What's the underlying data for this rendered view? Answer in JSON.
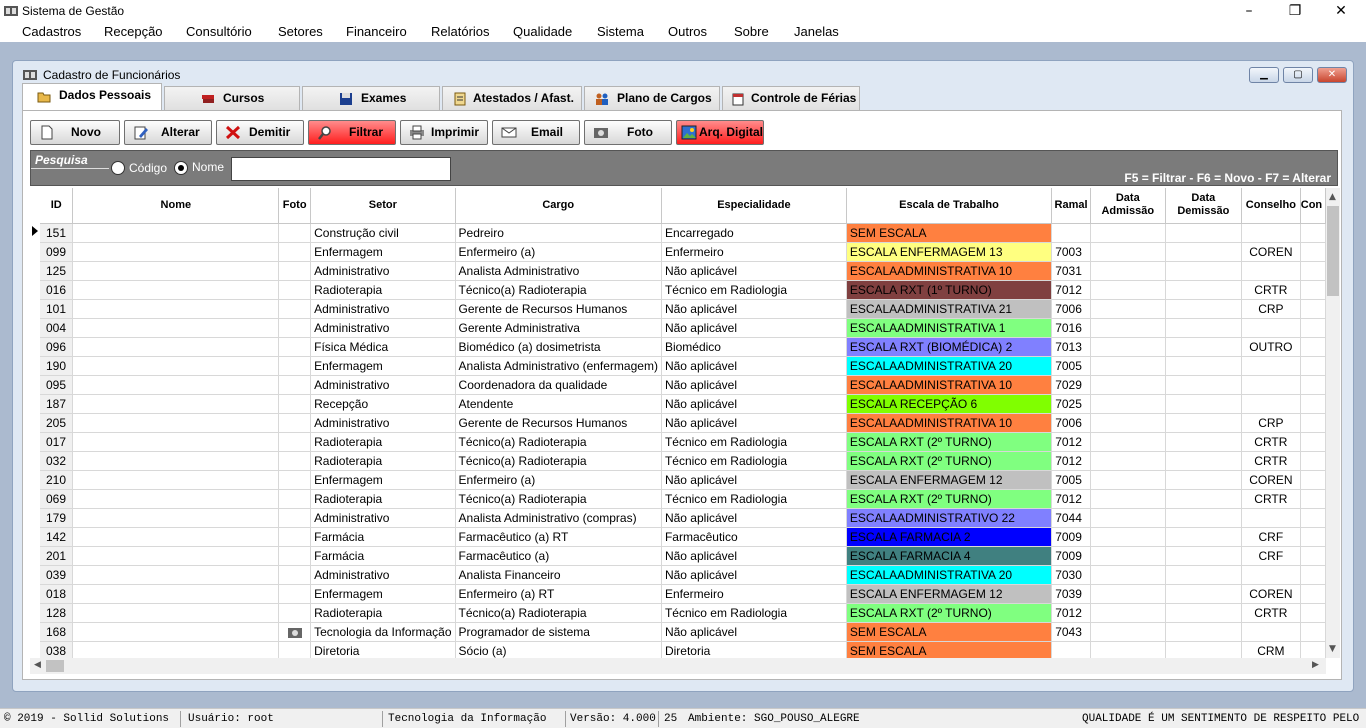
{
  "app": {
    "title": "Sistema de Gestão"
  },
  "menu": [
    "Cadastros",
    "Recepção",
    "Consultório",
    "Setores",
    "Financeiro",
    "Relatórios",
    "Qualidade",
    "Sistema",
    "Outros",
    "Sobre",
    "Janelas"
  ],
  "window": {
    "title": "Cadastro de Funcionários"
  },
  "tabs": [
    {
      "label": "Dados Pessoais",
      "icon": "folder-icon"
    },
    {
      "label": "Cursos",
      "icon": "books-icon"
    },
    {
      "label": "Exames",
      "icon": "disk-icon"
    },
    {
      "label": "Atestados / Afast.",
      "icon": "clipboard-icon"
    },
    {
      "label": "Plano de Cargos",
      "icon": "people-icon"
    },
    {
      "label": "Controle de Férias",
      "icon": "calendar-icon"
    }
  ],
  "toolbar": {
    "novo": "Novo",
    "alterar": "Alterar",
    "demitir": "Demitir",
    "filtrar": "Filtrar",
    "imprimir": "Imprimir",
    "email": "Email",
    "foto": "Foto",
    "arq": "Arq. Digital"
  },
  "search": {
    "tab": "Pesquisa",
    "codigo": "Código",
    "nome": "Nome",
    "value": "",
    "hint": "F5 = Filtrar  -  F6 = Novo  -  F7 = Alterar"
  },
  "columns": [
    "ID",
    "Nome",
    "Foto",
    "Setor",
    "Cargo",
    "Especialidade",
    "Escala de Trabalho",
    "Ramal",
    "Data Admissão",
    "Data Demissão",
    "Conselho",
    "Con"
  ],
  "rows": [
    {
      "id": "151",
      "setor": "Construção civil",
      "cargo": "Pedreiro",
      "esp": "Encarregado",
      "escala": "SEM ESCALA",
      "color": "#ff8040",
      "ramal": "",
      "conselho": ""
    },
    {
      "id": "099",
      "setor": "Enfermagem",
      "cargo": "Enfermeiro (a)",
      "esp": "Enfermeiro",
      "escala": "ESCALA ENFERMAGEM 13",
      "color": "#ffff80",
      "ramal": "7003",
      "conselho": "COREN"
    },
    {
      "id": "125",
      "setor": "Administrativo",
      "cargo": "Analista Administrativo",
      "esp": "Não aplicável",
      "escala": "ESCALAADMINISTRATIVA 10",
      "color": "#ff8040",
      "ramal": "7031",
      "conselho": ""
    },
    {
      "id": "016",
      "setor": "Radioterapia",
      "cargo": "Técnico(a) Radioterapia",
      "esp": "Técnico em Radiologia",
      "escala": "ESCALA RXT (1º TURNO)",
      "color": "#804040",
      "ramal": "7012",
      "conselho": "CRTR"
    },
    {
      "id": "101",
      "setor": "Administrativo",
      "cargo": "Gerente de Recursos Humanos",
      "esp": "Não aplicável",
      "escala": "ESCALAADMINISTRATIVA 21",
      "color": "#c0c0c0",
      "ramal": "7006",
      "conselho": "CRP"
    },
    {
      "id": "004",
      "setor": "Administrativo",
      "cargo": "Gerente Administrativa",
      "esp": "Não aplicável",
      "escala": "ESCALAADMINISTRATIVA 1",
      "color": "#80ff80",
      "ramal": "7016",
      "conselho": ""
    },
    {
      "id": "096",
      "setor": "Física Médica",
      "cargo": "Biomédico (a) dosimetrista",
      "esp": "Biomédico",
      "escala": "ESCALA RXT (BIOMÉDICA) 2",
      "color": "#8080ff",
      "ramal": "7013",
      "conselho": "OUTRO"
    },
    {
      "id": "190",
      "setor": "Enfermagem",
      "cargo": "Analista Administrativo (enfermagem)",
      "esp": "Não aplicável",
      "escala": "ESCALAADMINISTRATIVA 20",
      "color": "#00ffff",
      "ramal": "7005",
      "conselho": ""
    },
    {
      "id": "095",
      "setor": "Administrativo",
      "cargo": "Coordenadora da qualidade",
      "esp": "Não aplicável",
      "escala": "ESCALAADMINISTRATIVA 10",
      "color": "#ff8040",
      "ramal": "7029",
      "conselho": ""
    },
    {
      "id": "187",
      "setor": "Recepção",
      "cargo": "Atendente",
      "esp": "Não aplicável",
      "escala": "ESCALA RECEPÇÃO 6",
      "color": "#80ff00",
      "ramal": "7025",
      "conselho": ""
    },
    {
      "id": "205",
      "setor": "Administrativo",
      "cargo": "Gerente de Recursos Humanos",
      "esp": "Não aplicável",
      "escala": "ESCALAADMINISTRATIVA 10",
      "color": "#ff8040",
      "ramal": "7006",
      "conselho": "CRP"
    },
    {
      "id": "017",
      "setor": "Radioterapia",
      "cargo": "Técnico(a) Radioterapia",
      "esp": "Técnico em Radiologia",
      "escala": "ESCALA RXT (2º TURNO)",
      "color": "#80ff80",
      "ramal": "7012",
      "conselho": "CRTR"
    },
    {
      "id": "032",
      "setor": "Radioterapia",
      "cargo": "Técnico(a) Radioterapia",
      "esp": "Técnico em Radiologia",
      "escala": "ESCALA RXT (2º TURNO)",
      "color": "#80ff80",
      "ramal": "7012",
      "conselho": "CRTR"
    },
    {
      "id": "210",
      "setor": "Enfermagem",
      "cargo": "Enfermeiro (a)",
      "esp": "Não aplicável",
      "escala": "ESCALA ENFERMAGEM 12",
      "color": "#c0c0c0",
      "ramal": "7005",
      "conselho": "COREN"
    },
    {
      "id": "069",
      "setor": "Radioterapia",
      "cargo": "Técnico(a) Radioterapia",
      "esp": "Técnico em Radiologia",
      "escala": "ESCALA RXT (2º TURNO)",
      "color": "#80ff80",
      "ramal": "7012",
      "conselho": "CRTR"
    },
    {
      "id": "179",
      "setor": "Administrativo",
      "cargo": "Analista Administrativo (compras)",
      "esp": "Não aplicável",
      "escala": "ESCALAADMINISTRATIVO 22",
      "color": "#8080ff",
      "ramal": "7044",
      "conselho": ""
    },
    {
      "id": "142",
      "setor": "Farmácia",
      "cargo": "Farmacêutico (a) RT",
      "esp": "Farmacêutico",
      "escala": "ESCALA FARMACIA 2",
      "color": "#0000ff",
      "ramal": "7009",
      "conselho": "CRF"
    },
    {
      "id": "201",
      "setor": "Farmácia",
      "cargo": "Farmacêutico (a)",
      "esp": "Não aplicável",
      "escala": "ESCALA FARMACIA 4",
      "color": "#408080",
      "ramal": "7009",
      "conselho": "CRF"
    },
    {
      "id": "039",
      "setor": "Administrativo",
      "cargo": "Analista Financeiro",
      "esp": "Não aplicável",
      "escala": "ESCALAADMINISTRATIVA 20",
      "color": "#00ffff",
      "ramal": "7030",
      "conselho": ""
    },
    {
      "id": "018",
      "setor": "Enfermagem",
      "cargo": "Enfermeiro (a) RT",
      "esp": "Enfermeiro",
      "escala": "ESCALA ENFERMAGEM 12",
      "color": "#c0c0c0",
      "ramal": "7039",
      "conselho": "COREN"
    },
    {
      "id": "128",
      "setor": "Radioterapia",
      "cargo": "Técnico(a) Radioterapia",
      "esp": "Técnico em Radiologia",
      "escala": "ESCALA RXT (2º TURNO)",
      "color": "#80ff80",
      "ramal": "7012",
      "conselho": "CRTR"
    },
    {
      "id": "168",
      "setor": "Tecnologia da Informação",
      "cargo": "Programador de sistema",
      "esp": "Não aplicável",
      "escala": "SEM ESCALA",
      "color": "#ff8040",
      "ramal": "7043",
      "conselho": "",
      "foto": true
    },
    {
      "id": "038",
      "setor": "Diretoria",
      "cargo": "Sócio (a)",
      "esp": "Diretoria",
      "escala": "SEM ESCALA",
      "color": "#ff8040",
      "ramal": "",
      "conselho": "CRM"
    }
  ],
  "status": {
    "copyright": "© 2019 - Sollid Solutions",
    "user": "Usuário: root",
    "sector": "Tecnologia da Informação",
    "version": "Versão: 4.000",
    "count": "25",
    "env": "Ambiente: SGO_POUSO_ALEGRE",
    "motto": "QUALIDADE É UM SENTIMENTO DE RESPEITO PELO PRÓX"
  }
}
